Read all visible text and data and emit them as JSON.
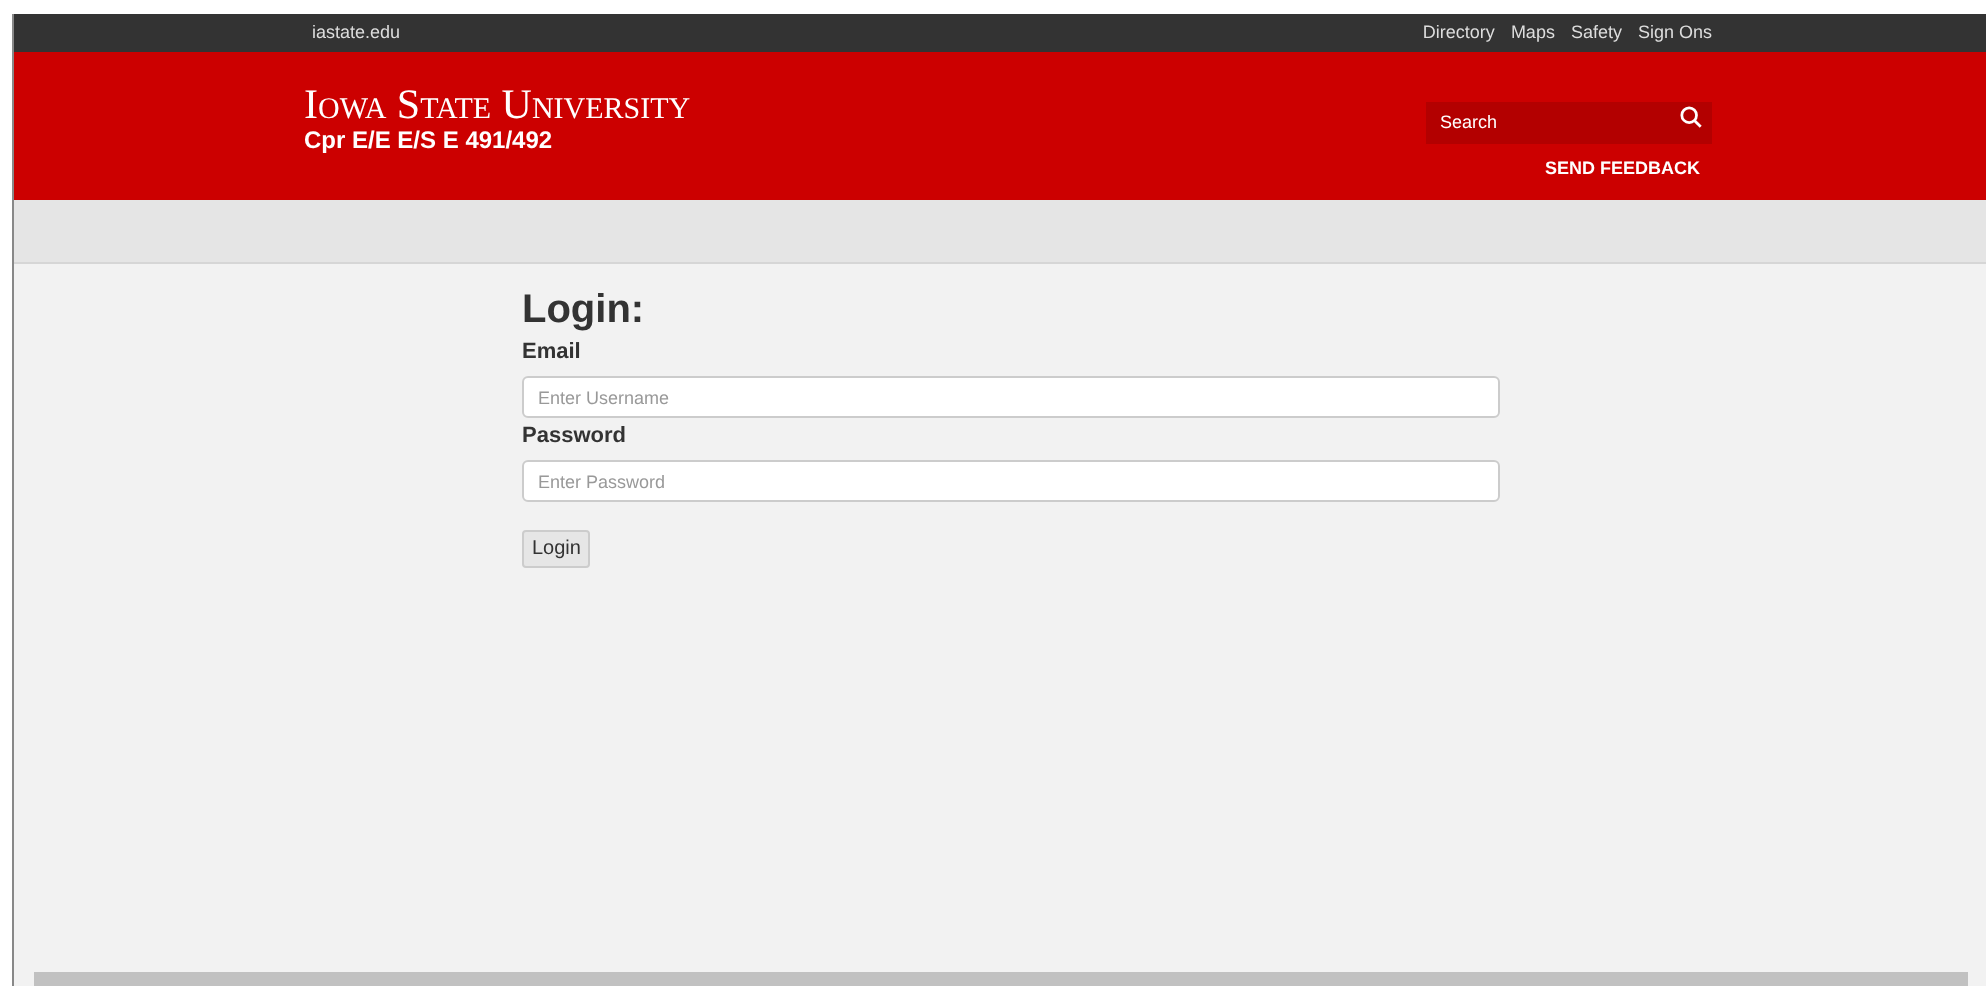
{
  "top_bar": {
    "site_link": "iastate.edu",
    "links": [
      "Directory",
      "Maps",
      "Safety",
      "Sign Ons"
    ]
  },
  "header": {
    "wordmark": "Iowa State University",
    "subtitle": "Cpr E/E E/S E 491/492",
    "search": {
      "placeholder": "Search"
    },
    "feedback_link": "SEND FEEDBACK"
  },
  "login": {
    "title": "Login:",
    "fields": [
      {
        "label": "Email",
        "placeholder": "Enter Username"
      },
      {
        "label": "Password",
        "placeholder": "Enter Password"
      }
    ],
    "button": "Login"
  }
}
